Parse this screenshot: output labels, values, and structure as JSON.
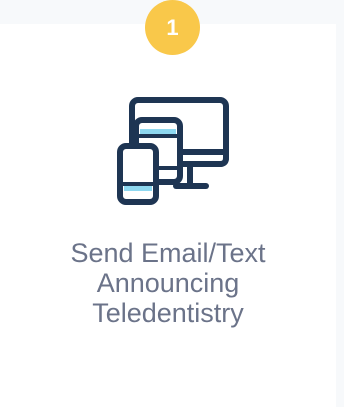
{
  "step": {
    "number": "1"
  },
  "card": {
    "icon": "devices-icon",
    "title_lines": [
      "Send Email/Text",
      "Announcing",
      "Teledentistry"
    ]
  },
  "colors": {
    "badge": "#f9c84a",
    "icon_stroke": "#1e3553",
    "icon_accent": "#8ed8f0",
    "caption": "#6b7389",
    "card_background": "#ffffff",
    "page_background": "#f7f9fb"
  }
}
